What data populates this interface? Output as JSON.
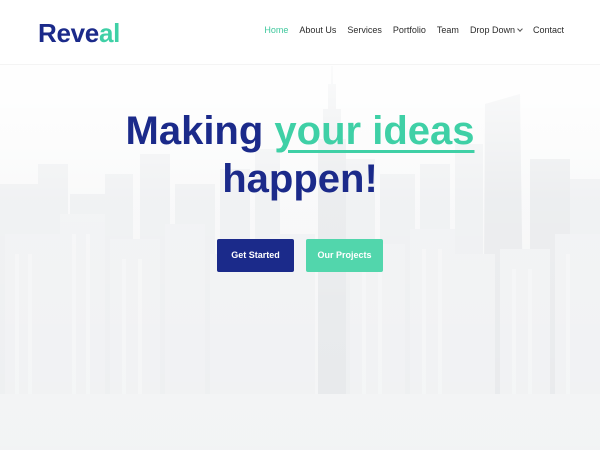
{
  "logo": {
    "part1": "Reve",
    "part2": "al"
  },
  "nav": {
    "items": [
      {
        "label": "Home",
        "active": true
      },
      {
        "label": "About Us"
      },
      {
        "label": "Services"
      },
      {
        "label": "Portfolio"
      },
      {
        "label": "Team"
      },
      {
        "label": "Drop Down",
        "has_dropdown": true
      },
      {
        "label": "Contact"
      }
    ]
  },
  "hero": {
    "headline_part1": "Making ",
    "headline_accent": "your ideas",
    "headline_part2": "happen!",
    "buttons": {
      "primary": "Get Started",
      "secondary": "Our Projects"
    }
  },
  "colors": {
    "brand_dark": "#1b2a8a",
    "brand_accent": "#3fd0a6",
    "nav_active": "#3fc89d"
  }
}
